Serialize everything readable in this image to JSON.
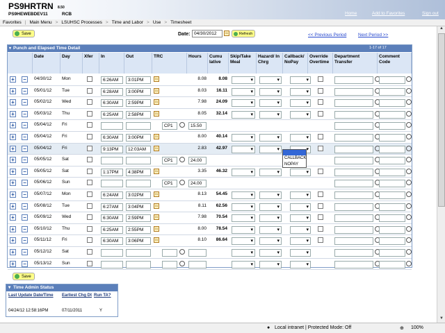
{
  "header": {
    "title": "PS9HRTRN",
    "version": "8.50",
    "database": "PS9HEWEBDEV11",
    "user": "RCB",
    "links": [
      "Home",
      "Add to Favorites",
      "Sign out"
    ]
  },
  "breadcrumb": [
    "Favorites",
    "Main Menu",
    "LSUHSC Processes",
    "Time and Labor",
    "Use",
    "Timesheet"
  ],
  "toolbar": {
    "save_label": "Save",
    "date_label": "Date:",
    "date_value": "04/30/2012",
    "refresh_label": "Refresh",
    "prev_period": "<< Previous Period",
    "next_period": "Next Period >>"
  },
  "grid": {
    "title": "Punch and Elapsed Time Detail",
    "count": "1-17 of 17",
    "columns": [
      "Date",
      "Day",
      "Xfer",
      "In",
      "Out",
      "TRC",
      "Hours",
      "Cumu lative",
      "Skip/Take Meal",
      "Hazard/ In Chrg",
      "Callback/ NoPay",
      "Override Overtime",
      "Department Transfer",
      "Comment Code"
    ],
    "rows": [
      {
        "date": "04/30/12",
        "day": "Mon",
        "in": "6:26AM",
        "out": "3:01PM",
        "trc": "",
        "hours": "8.08",
        "cum": "8.08"
      },
      {
        "date": "05/01/12",
        "day": "Tue",
        "in": "6:28AM",
        "out": "3:00PM",
        "trc": "",
        "hours": "8.03",
        "cum": "16.11"
      },
      {
        "date": "05/02/12",
        "day": "Wed",
        "in": "6:30AM",
        "out": "2:59PM",
        "trc": "",
        "hours": "7.98",
        "cum": "24.09"
      },
      {
        "date": "05/03/12",
        "day": "Thu",
        "in": "6:25AM",
        "out": "2:58PM",
        "trc": "",
        "hours": "8.05",
        "cum": "32.14"
      },
      {
        "date": "05/04/12",
        "day": "Fri",
        "in": "",
        "out": "",
        "trc": "CP1",
        "hours": "15.50",
        "cum": ""
      },
      {
        "date": "05/04/12",
        "day": "Fri",
        "in": "6:30AM",
        "out": "3:00PM",
        "trc": "",
        "hours": "8.00",
        "cum": "40.14"
      },
      {
        "date": "05/04/12",
        "day": "Fri",
        "in": "9:13PM",
        "out": "12:03AM",
        "trc": "",
        "hours": "2.83",
        "cum": "42.97"
      },
      {
        "date": "05/05/12",
        "day": "Sat",
        "in": "",
        "out": "",
        "trc": "CP1",
        "hours": "24.00",
        "cum": ""
      },
      {
        "date": "05/05/12",
        "day": "Sat",
        "in": "1:17PM",
        "out": "4:38PM",
        "trc": "",
        "hours": "3.35",
        "cum": "46.32"
      },
      {
        "date": "05/06/12",
        "day": "Sun",
        "in": "",
        "out": "",
        "trc": "CP1",
        "hours": "24.00",
        "cum": ""
      },
      {
        "date": "05/07/12",
        "day": "Mon",
        "in": "6:24AM",
        "out": "3:02PM",
        "trc": "",
        "hours": "8.13",
        "cum": "54.45"
      },
      {
        "date": "05/08/12",
        "day": "Tue",
        "in": "6:27AM",
        "out": "3:04PM",
        "trc": "",
        "hours": "8.11",
        "cum": "62.56"
      },
      {
        "date": "05/09/12",
        "day": "Wed",
        "in": "6:30AM",
        "out": "2:59PM",
        "trc": "",
        "hours": "7.98",
        "cum": "70.54"
      },
      {
        "date": "05/10/12",
        "day": "Thu",
        "in": "6:25AM",
        "out": "2:55PM",
        "trc": "",
        "hours": "8.00",
        "cum": "78.54"
      },
      {
        "date": "05/11/12",
        "day": "Fri",
        "in": "6:30AM",
        "out": "3:06PM",
        "trc": "",
        "hours": "8.10",
        "cum": "86.64"
      },
      {
        "date": "05/12/12",
        "day": "Sat",
        "in": "",
        "out": "",
        "trc": "",
        "hours": "",
        "cum": ""
      },
      {
        "date": "05/13/12",
        "day": "Sun",
        "in": "",
        "out": "",
        "trc": "",
        "hours": "",
        "cum": ""
      }
    ],
    "callback_options": [
      "",
      "CALLBACK",
      "NOPAY"
    ]
  },
  "status": {
    "title": "Time Admin Status",
    "headers": [
      "Last Update Date/Time",
      "Earliest Chg Dt",
      "Run TA?"
    ],
    "values": [
      "04/24/12 12:58:16PM",
      "07/11/2011",
      "Y"
    ]
  },
  "statusbar": {
    "zone": "Local intranet | Protected Mode: Off",
    "zoom": "100%"
  }
}
